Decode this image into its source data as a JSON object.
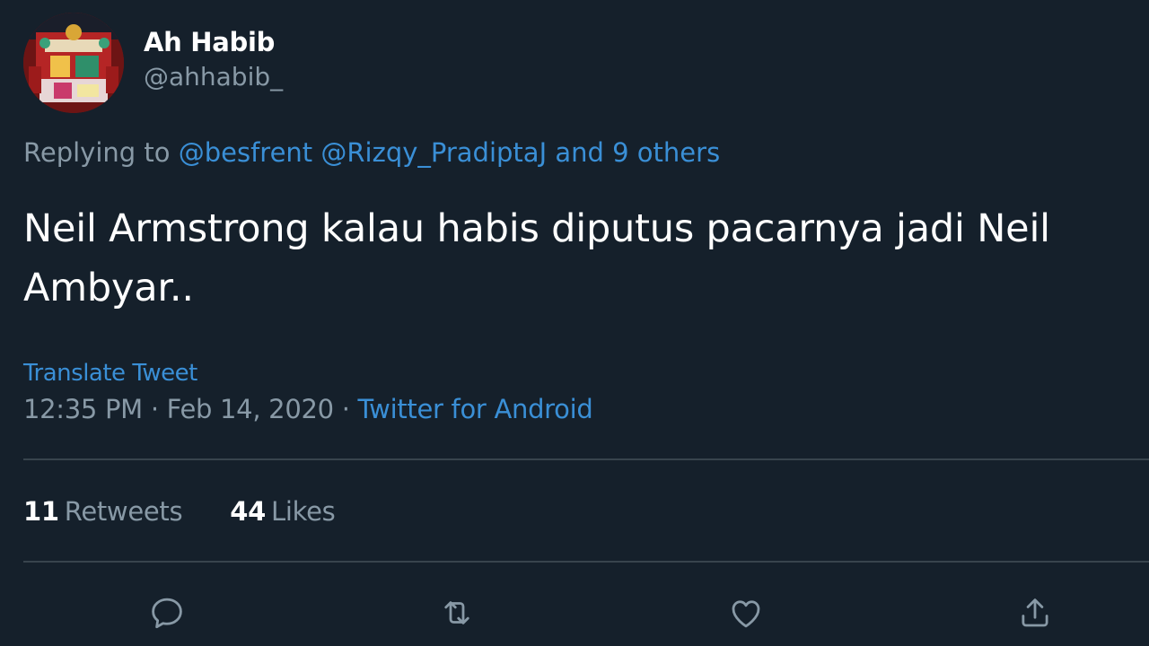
{
  "author": {
    "display_name": "Ah Habib",
    "handle": "@ahhabib_"
  },
  "reply": {
    "prefix": "Replying to",
    "mentions": [
      "@besfrent",
      "@Rizqy_PradiptaJ"
    ],
    "and": "and",
    "others": "9 others"
  },
  "tweet": {
    "text": "Neil Armstrong kalau habis diputus pacarnya jadi Neil Ambyar..",
    "translate_label": "Translate Tweet",
    "time": "12:35 PM",
    "date": "Feb 14, 2020",
    "source": "Twitter for Android",
    "separator": "·"
  },
  "stats": {
    "retweets_count": "11",
    "retweets_label": "Retweets",
    "likes_count": "44",
    "likes_label": "Likes"
  },
  "actions": {
    "icons": [
      "reply-icon",
      "retweet-icon",
      "like-icon",
      "share-icon"
    ],
    "icon_color": "#8899a6"
  },
  "colors": {
    "background": "#15202b",
    "link": "#1da1f2",
    "secondary_text": "#8899a6",
    "divider": "#38444d"
  }
}
